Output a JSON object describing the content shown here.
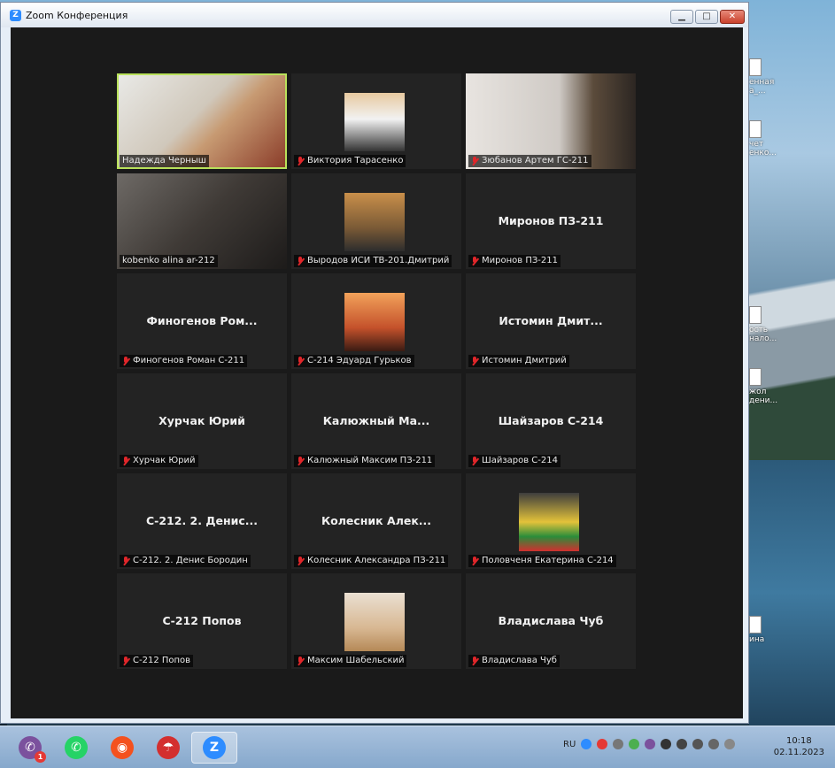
{
  "window": {
    "title": "Zoom Конференция",
    "min_label": "▁",
    "max_label": "□",
    "close_label": "✕"
  },
  "participants": [
    {
      "name": "Надежда Черныш",
      "big": "",
      "video": true,
      "muted": false,
      "active": true
    },
    {
      "name": "Виктория Тарасенко",
      "big": "",
      "video": true,
      "muted": true,
      "active": false
    },
    {
      "name": "Зюбанов Артем ГС-211",
      "big": "",
      "video": true,
      "muted": true,
      "active": false
    },
    {
      "name": "kobenko alina ar-212",
      "big": "",
      "video": true,
      "muted": false,
      "active": false
    },
    {
      "name": "Выродов ИСИ ТВ-201.Дмитрий",
      "big": "",
      "video": true,
      "muted": true,
      "active": false
    },
    {
      "name": "Миронов ПЗ-211",
      "big": "Миронов ПЗ-211",
      "video": false,
      "muted": true,
      "active": false
    },
    {
      "name": "Финогенов Роман С-211",
      "big": "Финогенов  Ром...",
      "video": false,
      "muted": true,
      "active": false
    },
    {
      "name": "С-214 Эдуард Гурьков",
      "big": "",
      "video": true,
      "muted": true,
      "active": false
    },
    {
      "name": "Истомин Дмитрий",
      "big": "Истомин  Дмит...",
      "video": false,
      "muted": true,
      "active": false
    },
    {
      "name": "Хурчак Юрий",
      "big": "Хурчак Юрий",
      "video": false,
      "muted": true,
      "active": false
    },
    {
      "name": "Калюжный Максим ПЗ-211",
      "big": "Калюжный  Ма...",
      "video": false,
      "muted": true,
      "active": false
    },
    {
      "name": "Шайзаров С-214",
      "big": "Шайзаров С-214",
      "video": false,
      "muted": true,
      "active": false
    },
    {
      "name": "С-212. 2. Денис Бородин",
      "big": "С-212. 2. Денис...",
      "video": false,
      "muted": true,
      "active": false
    },
    {
      "name": "Колесник Александра ПЗ-211",
      "big": "Колесник  Алек...",
      "video": false,
      "muted": true,
      "active": false
    },
    {
      "name": "Половченя Екатерина С-214",
      "big": "",
      "video": true,
      "muted": true,
      "active": false
    },
    {
      "name": "С-212 Попов",
      "big": "С-212 Попов",
      "video": false,
      "muted": true,
      "active": false
    },
    {
      "name": "Максим Шабельский",
      "big": "",
      "video": true,
      "muted": true,
      "active": false
    },
    {
      "name": "Владислава Чуб",
      "big": "Владислава Чуб",
      "video": false,
      "muted": true,
      "active": false
    }
  ],
  "desktop_icons": [
    {
      "label": "енная\nа_..."
    },
    {
      "label": "чет\nенко..."
    },
    {
      "label": "ость\nнало..."
    },
    {
      "label": "жол\nдени..."
    },
    {
      "label": "ина"
    }
  ],
  "taskbar": {
    "apps": [
      {
        "name": "viber",
        "glyph": "✆",
        "color": "#7b519d",
        "badge": "1",
        "active": false
      },
      {
        "name": "whatsapp",
        "glyph": "✆",
        "color": "#25d366",
        "badge": "",
        "active": false
      },
      {
        "name": "screen-recorder",
        "glyph": "◉",
        "color": "#f4511e",
        "badge": "",
        "active": false
      },
      {
        "name": "umbrella-app",
        "glyph": "☂",
        "color": "#d32f2f",
        "badge": "",
        "active": false
      },
      {
        "name": "zoom",
        "glyph": "Z",
        "color": "#2d8cff",
        "badge": "",
        "active": true
      }
    ],
    "language": "RU",
    "time": "10:18",
    "date": "02.11.2023"
  }
}
